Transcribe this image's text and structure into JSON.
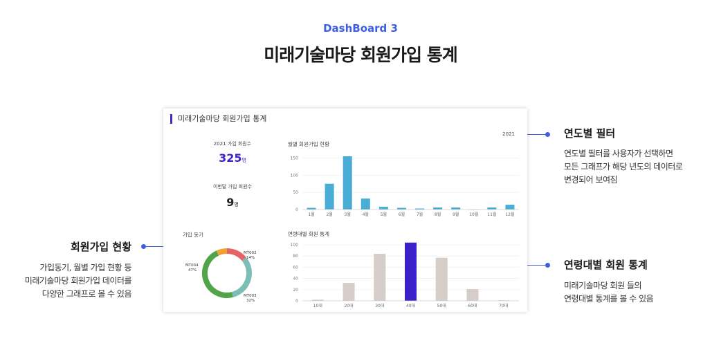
{
  "header": {
    "subtitle": "DashBoard 3",
    "title": "미래기술마당 회원가입 통계"
  },
  "panel": {
    "title": "미래기술마당 회원가입 통계",
    "year": "2021",
    "stat1": {
      "label": "2021 가입 회원수",
      "value": "325",
      "unit": "명"
    },
    "stat2": {
      "label": "이번달 가입 회원수",
      "value": "9",
      "unit": "명"
    }
  },
  "colors": {
    "accent": "#3d5fe0",
    "bar_blue": "#4aadd6",
    "bar_highlight": "#3b1fc8",
    "bar_gray": "#d6ccc8"
  },
  "chart_data": [
    {
      "type": "bar",
      "title": "월별 회원가입 현황",
      "categories": [
        "1월",
        "2월",
        "3월",
        "4월",
        "5월",
        "6월",
        "7월",
        "8월",
        "9월",
        "10월",
        "11월",
        "12월"
      ],
      "values": [
        5,
        75,
        155,
        32,
        8,
        5,
        3,
        6,
        6,
        1,
        6,
        14
      ],
      "yticks": [
        0,
        50,
        100,
        150
      ],
      "ylim": [
        0,
        165
      ]
    },
    {
      "type": "pie",
      "title": "가입 동기",
      "slices": [
        {
          "label": "MT002",
          "pct": "14%",
          "value": 14,
          "color": "#e56566"
        },
        {
          "label": "MT003",
          "pct": "32%",
          "value": 32,
          "color": "#7dbdb8"
        },
        {
          "label": "MT004",
          "pct": "47%",
          "value": 47,
          "color": "#52a44a"
        },
        {
          "label": "",
          "pct": "",
          "value": 7,
          "color": "#f1a133"
        }
      ]
    },
    {
      "type": "bar",
      "title": "연령대별 회원 통계",
      "categories": [
        "10대",
        "20대",
        "30대",
        "40대",
        "50대",
        "60대",
        "70대"
      ],
      "values": [
        2,
        32,
        84,
        104,
        77,
        21,
        1
      ],
      "highlight_index": 3,
      "yticks": [
        0,
        20,
        40,
        60,
        80,
        100
      ],
      "ylim": [
        0,
        105
      ]
    }
  ],
  "annotations": {
    "year_filter": {
      "heading": "연도별 필터",
      "lines": [
        "연도별 필터를 사용자가 선택하면",
        "모든 그래프가 해당 년도의 데이터로",
        "변경되어  보여짐"
      ]
    },
    "signup_status": {
      "heading": "회원가입 현황",
      "lines": [
        "가입동기, 월별 가입 현황 등",
        "미래기술마당 회원가입 데이터를",
        "다양한 그래프로 볼 수 있음"
      ]
    },
    "age_stats": {
      "heading": "연령대별 회원 통계",
      "lines": [
        "미래기술마당 회원 들의",
        "연령대별 통계를 볼 수 있음"
      ]
    }
  }
}
